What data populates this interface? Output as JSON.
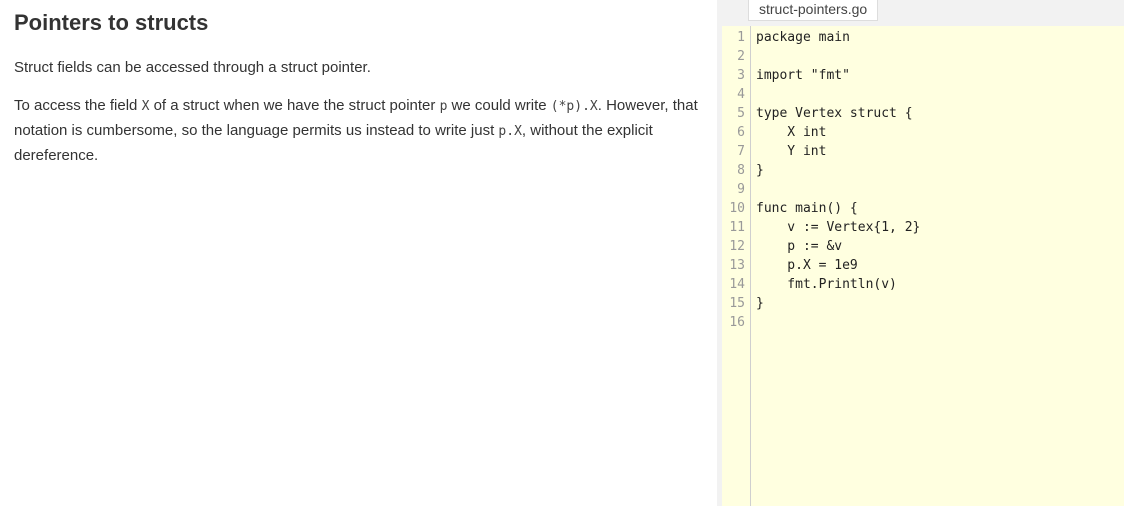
{
  "lesson": {
    "title": "Pointers to structs",
    "para1": "Struct fields can be accessed through a struct pointer.",
    "para2": {
      "t1": "To access the field ",
      "c1": "X",
      "t2": " of a struct when we have the struct pointer ",
      "c2": "p",
      "t3": " we could write ",
      "c3": "(*p).X",
      "t4": ". However, that notation is cumbersome, so the language permits us instead to write just ",
      "c4": "p.X",
      "t5": ", without the explicit dereference."
    }
  },
  "editor": {
    "filename": "struct-pointers.go",
    "lines": [
      {
        "no": "1",
        "text": "package main"
      },
      {
        "no": "2",
        "text": ""
      },
      {
        "no": "3",
        "text": "import \"fmt\""
      },
      {
        "no": "4",
        "text": ""
      },
      {
        "no": "5",
        "text": "type Vertex struct {"
      },
      {
        "no": "6",
        "text": "    X int"
      },
      {
        "no": "7",
        "text": "    Y int"
      },
      {
        "no": "8",
        "text": "}"
      },
      {
        "no": "9",
        "text": ""
      },
      {
        "no": "10",
        "text": "func main() {"
      },
      {
        "no": "11",
        "text": "    v := Vertex{1, 2}"
      },
      {
        "no": "12",
        "text": "    p := &v"
      },
      {
        "no": "13",
        "text": "    p.X = 1e9"
      },
      {
        "no": "14",
        "text": "    fmt.Println(v)"
      },
      {
        "no": "15",
        "text": "}"
      },
      {
        "no": "16",
        "text": ""
      }
    ]
  }
}
